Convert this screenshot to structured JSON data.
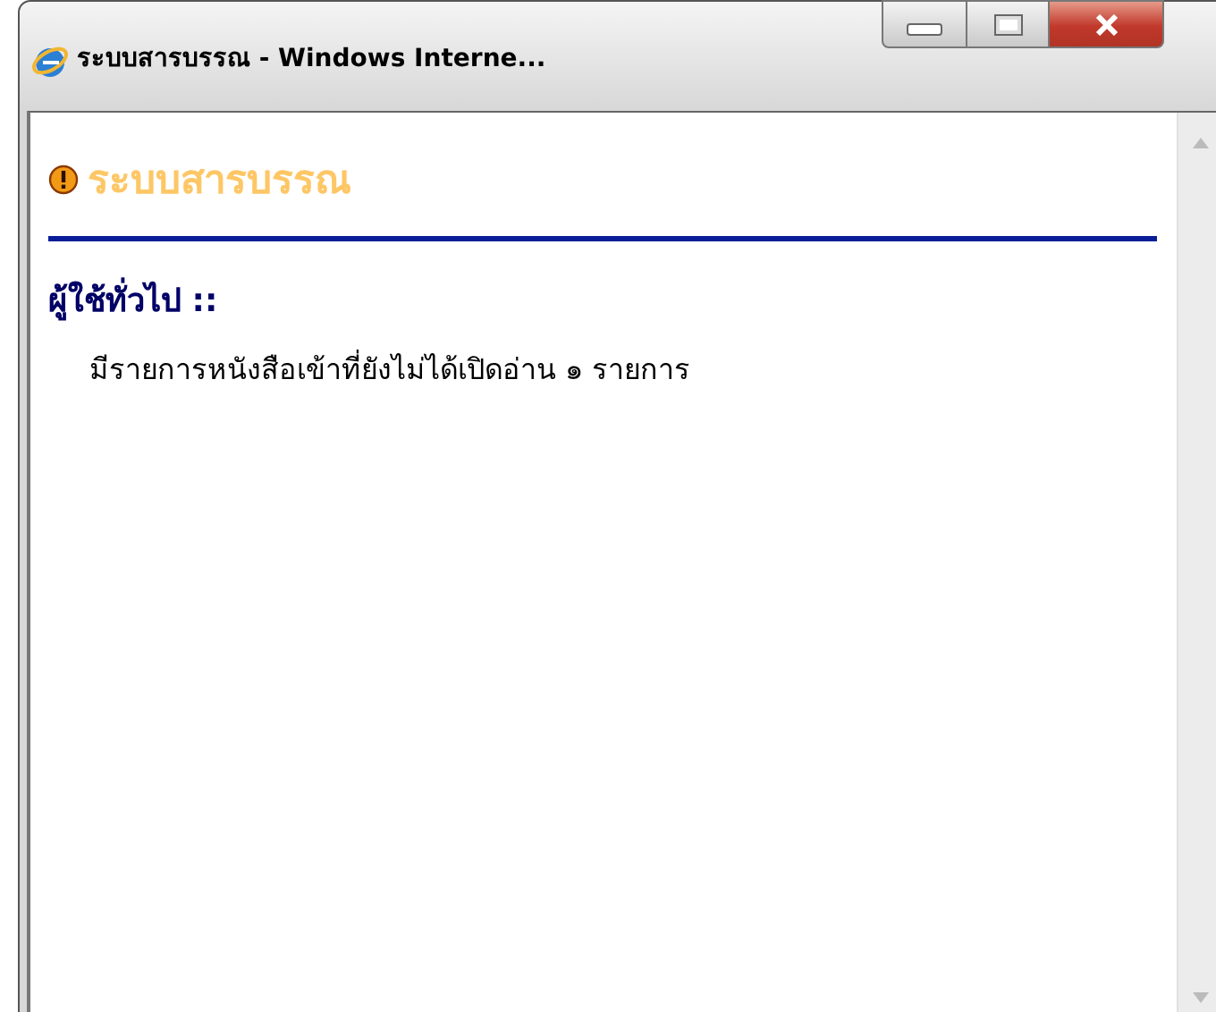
{
  "window": {
    "title": "ระบบสารบรรณ - Windows Interne..."
  },
  "page": {
    "heading": "ระบบสารบรรณ",
    "section_title": "ผู้ใช้ทั่วไป ::",
    "message": "มีรายการหนังสือเข้าที่ยังไม่ได้เปิดอ่าน ๑ รายการ"
  }
}
